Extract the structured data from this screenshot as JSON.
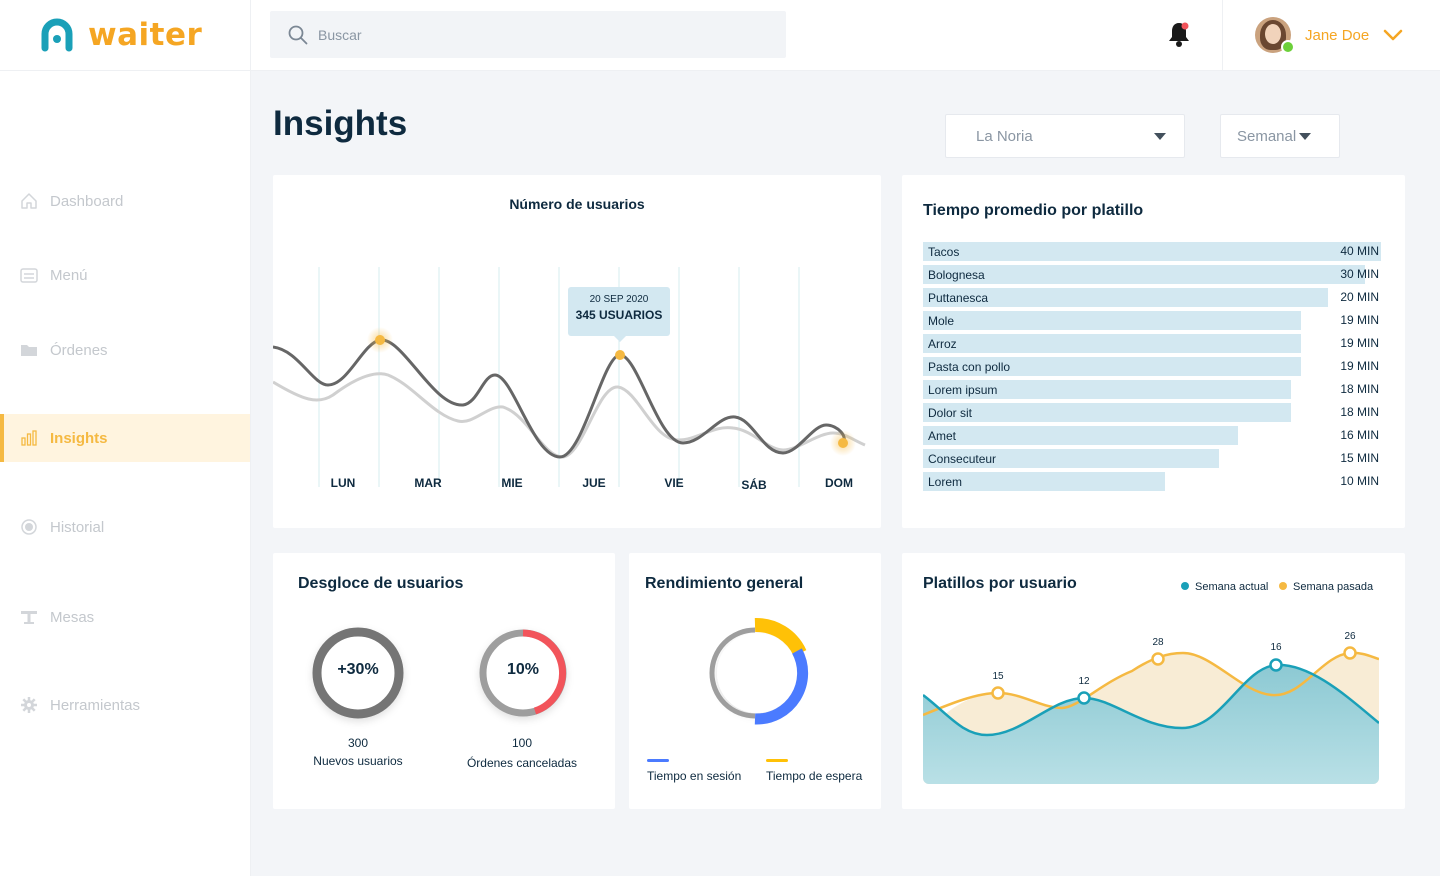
{
  "app": {
    "logo": "waiter"
  },
  "search": {
    "placeholder": "Buscar"
  },
  "user": {
    "name": "Jane Doe"
  },
  "colors": {
    "accent": "#f5a623",
    "teal": "#1aa0b8",
    "blue": "#4b7bff",
    "red": "#f2545b",
    "dark": "#0e2a3f"
  },
  "sidebar": {
    "items": [
      {
        "label": "Dashboard",
        "icon": "home-icon",
        "active": false
      },
      {
        "label": "Menú",
        "icon": "menu-icon",
        "active": false
      },
      {
        "label": "Órdenes",
        "icon": "folder-icon",
        "active": false
      },
      {
        "label": "Insights",
        "icon": "bar-chart-icon",
        "active": true
      },
      {
        "label": "Historial",
        "icon": "history-icon",
        "active": false
      },
      {
        "label": "Mesas",
        "icon": "table-icon",
        "active": false
      },
      {
        "label": "Herramientas",
        "icon": "gear-icon",
        "active": false
      }
    ]
  },
  "header": {
    "title": "Insights",
    "location_select": "La Noria",
    "period_select": "Semanal"
  },
  "users_chart": {
    "title": "Número de usuarios",
    "tooltip_date": "20 SEP 2020",
    "tooltip_value": "345 USUARIOS"
  },
  "dish_time": {
    "title": "Tiempo promedio por platillo"
  },
  "breakdown": {
    "title": "Desgloce de usuarios",
    "new_users_pct": "+30%",
    "new_users_count": "300",
    "new_users_label": "Nuevos usuarios",
    "cancelled_pct": "10%",
    "cancelled_count": "100",
    "cancelled_label": "Órdenes canceladas"
  },
  "performance": {
    "title": "Rendimiento general",
    "legend_session": "Tiempo en sesión",
    "legend_wait": "Tiempo de espera"
  },
  "dishes_per_user": {
    "title": "Platillos por usuario",
    "legend_current": "Semana actual",
    "legend_past": "Semana pasada"
  },
  "chart_data": [
    {
      "type": "line",
      "title": "Número de usuarios",
      "categories": [
        "LUN",
        "MAR",
        "MIE",
        "JUE",
        "VIE",
        "SÁB",
        "DOM"
      ],
      "series": [
        {
          "values": [
            330,
            250,
            270,
            345,
            230,
            235,
            225
          ]
        },
        {
          "values": [
            280,
            240,
            235,
            310,
            220,
            230,
            220
          ]
        }
      ],
      "annotations": [
        {
          "category": "JUE",
          "label": "20 SEP 2020",
          "value_label": "345 USUARIOS"
        }
      ]
    },
    {
      "type": "bar",
      "orientation": "horizontal",
      "title": "Tiempo promedio por platillo",
      "categories": [
        "Tacos",
        "Bolognesa",
        "Puttanesca",
        "Mole",
        "Arroz",
        "Pasta con pollo",
        "Lorem ipsum",
        "Dolor sit",
        "Amet",
        "Consecuteur",
        "Lorem"
      ],
      "values": [
        40,
        30,
        20,
        19,
        19,
        19,
        18,
        18,
        16,
        15,
        10
      ],
      "value_labels": [
        "40 MIN",
        "30 MIN",
        "20 MIN",
        "19 MIN",
        "19 MIN",
        "19 MIN",
        "18 MIN",
        "18 MIN",
        "16 MIN",
        "15 MIN",
        "10 MIN"
      ],
      "bar_fraction": [
        1.0,
        0.965,
        0.885,
        0.826,
        0.826,
        0.826,
        0.804,
        0.804,
        0.687,
        0.646,
        0.528
      ]
    },
    {
      "type": "pie",
      "title": "Rendimiento general",
      "slices": [
        {
          "name": "Tiempo en sesión",
          "value": 0.22,
          "color": "#4b7bff"
        },
        {
          "name": "Tiempo de espera",
          "value": 0.18,
          "color": "#ffc107"
        },
        {
          "name": "",
          "value": 0.6,
          "color": "#9e9e9e"
        }
      ]
    },
    {
      "type": "area",
      "title": "Platillos por usuario",
      "series": [
        {
          "name": "Semana pasada",
          "values": [
            null,
            15,
            12,
            28,
            null,
            26
          ],
          "color": "#f5b942"
        },
        {
          "name": "Semana actual",
          "values": [
            null,
            null,
            12,
            null,
            16,
            null
          ],
          "color": "#1aa0b8"
        }
      ],
      "point_labels": [
        "15",
        "12",
        "28",
        "16",
        "26"
      ]
    }
  ]
}
